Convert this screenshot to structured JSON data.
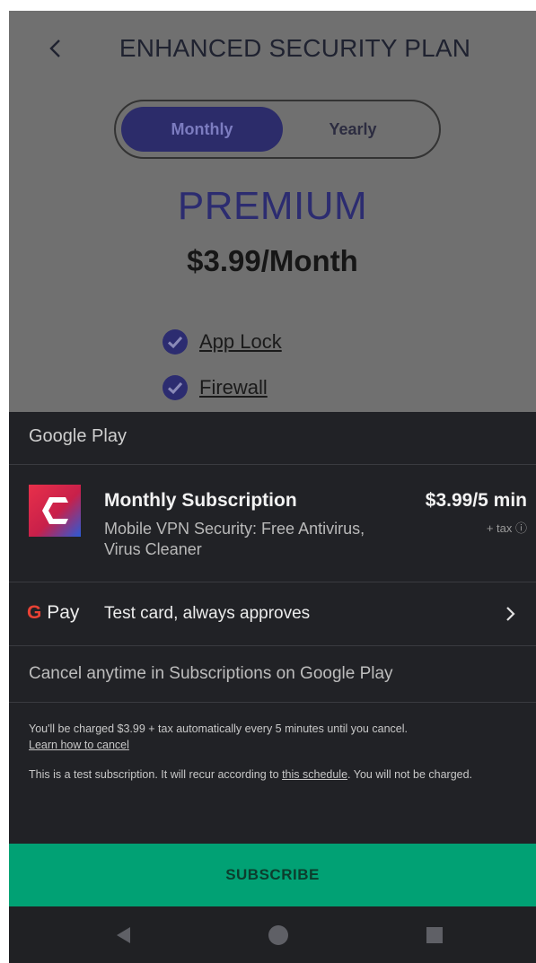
{
  "app": {
    "title": "ENHANCED SECURITY PLAN",
    "toggle": {
      "monthly": "Monthly",
      "yearly": "Yearly",
      "selected": "Monthly"
    },
    "plan_name": "PREMIUM",
    "plan_price": "$3.99/Month",
    "features": [
      "App Lock",
      "Firewall"
    ]
  },
  "sheet": {
    "brand": "Google Play",
    "product": {
      "title": "Monthly Subscription",
      "subtitle": "Mobile VPN Security: Free Antivirus, Virus Cleaner",
      "price": "$3.99/5 min",
      "tax": "+ tax ⓘ"
    },
    "payment": {
      "brand_g": "G",
      "brand_pay": "Pay",
      "method": "Test card, always approves"
    },
    "cancel_text": "Cancel anytime in Subscriptions on Google Play",
    "fine_print": {
      "charge_text": "You'll be charged $3.99 + tax automatically every 5 minutes until you cancel.",
      "learn_link": "Learn how to cancel",
      "test_text_a": "This is a test subscription. It will recur according to",
      "schedule_link": "this schedule",
      "test_text_b": ". You will not be charged."
    },
    "subscribe_label": "SUBSCRIBE"
  },
  "colors": {
    "accent_green": "#01a174",
    "sheet_bg": "#212226",
    "toggle_active": "#2c2c6a"
  }
}
